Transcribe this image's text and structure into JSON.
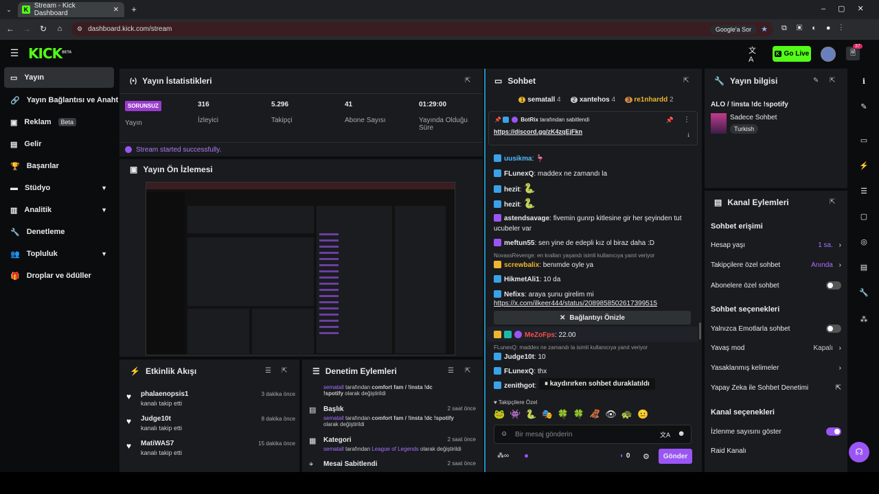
{
  "browser": {
    "tab_title": "Stream - Kick Dashboard",
    "url": "dashboard.kick.com/stream",
    "google_chip": "Google'a Sor"
  },
  "header": {
    "logo": "KICK",
    "logo_beta": "BETA",
    "go_live": "Go Live",
    "notif_count": "37"
  },
  "sidebar": {
    "items": [
      {
        "label": "Yayın"
      },
      {
        "label": "Yayın Bağlantısı ve Anahtar"
      },
      {
        "label": "Reklam",
        "badge": "Beta"
      },
      {
        "label": "Gelir"
      },
      {
        "label": "Başarılar"
      },
      {
        "label": "Stüdyo"
      },
      {
        "label": "Analitik"
      },
      {
        "label": "Denetleme"
      },
      {
        "label": "Topluluk"
      },
      {
        "label": "Droplar ve ödüller"
      }
    ]
  },
  "stats": {
    "title": "Yayın İstatistikleri",
    "offline_badge": "SORUNSUZ",
    "stream_label": "Yayın",
    "items": [
      {
        "value": "316",
        "label": "İzleyici"
      },
      {
        "value": "5.296",
        "label": "Takipçi"
      },
      {
        "value": "41",
        "label": "Abone Sayısı"
      },
      {
        "value": "01:29:00",
        "label": "Yayında Olduğu Süre"
      }
    ],
    "status_msg": "Stream started successfully."
  },
  "preview": {
    "title": "Yayın Ön İzlemesi"
  },
  "activity": {
    "title": "Etkinlik Akışı",
    "rows": [
      {
        "user": "phalaenopsis1",
        "sub": "kanalı takip etti",
        "time": "3 dakika önce"
      },
      {
        "user": "Judge10t",
        "sub": "kanalı takip etti",
        "time": "8 dakika önce"
      },
      {
        "user": "MatiWAS7",
        "sub": "kanalı takip etti",
        "time": "15 dakika önce"
      }
    ]
  },
  "moderation": {
    "title": "Denetim Eylemleri",
    "top_line_a": "sematall",
    "top_line_b": "tarafından",
    "top_line_c": "comfort fam / !insta !dc",
    "top_line2": "!spotify",
    "top_line2_b": "olarak değiştirildi",
    "rows": [
      {
        "title": "Başlık",
        "time": "2 saat önce",
        "by": "sematall",
        "mid": "tarafından",
        "value": "comfort fam / !insta !dc !spotify",
        "end": "olarak değiştirildi"
      },
      {
        "title": "Kategori",
        "time": "2 saat önce",
        "by": "sematall",
        "mid": "tarafından",
        "value": "League of Legends",
        "end": "olarak değiştirildi"
      },
      {
        "title": "Mesai Sabitlendi",
        "time": "2 saat önce"
      }
    ]
  },
  "chat": {
    "title": "Sohbet",
    "top_gifters": [
      {
        "rank": "1",
        "name": "sematall",
        "count": "4"
      },
      {
        "rank": "2",
        "name": "xantehos",
        "count": "4"
      },
      {
        "rank": "3",
        "name": "re1nhardd",
        "count": "2"
      }
    ],
    "pinned": {
      "by": "BotRix",
      "by_suffix": "tarafından sabitlendi",
      "link": "https://discord.gg/zK4zqEjFkn"
    },
    "messages": [
      {
        "user": "uusikma",
        "text": ":",
        "color": "#53b8ff"
      },
      {
        "user": "FLunexQ",
        "text": ": maddex ne zamandı la",
        "color": "#e8eaed"
      },
      {
        "user": "hezit",
        "text": ":",
        "color": "#e8eaed"
      },
      {
        "user": "hezit",
        "text": ":",
        "color": "#e8eaed"
      },
      {
        "user": "astendsavage",
        "text": ": fivemin gunrp kitlesine gir her şeyinden tut ucubeler var",
        "color": "#e8eaed"
      },
      {
        "user": "meftun55",
        "text": ": sen yine de edepli kız ol biraz daha :D",
        "color": "#e8eaed"
      },
      {
        "user": "screwbalix",
        "text": ": benımde oyle ya",
        "color": "#e8eaed"
      },
      {
        "user": "HikmetAli1",
        "text": ": 10 da",
        "color": "#e8eaed"
      },
      {
        "user": "Nefixs",
        "text": ": araya şunu girelim mi",
        "color": "#e8eaed"
      }
    ],
    "reply1": "NovassRevenge: en kralları yaşandı isimli kullanıcıya yanıt veriyor",
    "nefixs_link": "https://x.com/ilkeer444/status/2089858502617399515",
    "preview_btn": "Bağlantıyı Önizle",
    "mezo_user": "MeZoFps",
    "mezo_text": ": 22.00",
    "reply2": "FLunexQ: maddex ne zamandı la isimli kullanıcıya yanıt veriyor",
    "judge_user": "Judge10t",
    "judge_text": ": 10",
    "flu_user": "FLunexQ",
    "flu_text": ": thx",
    "zen_user": "zenithgot",
    "zen_text": ":",
    "paused": "kaydırırken sohbet duraklatıldı",
    "followers_only": "Takipçilere Özel",
    "placeholder": "Bir mesaj gönderin",
    "send": "Gönder",
    "points": "0"
  },
  "info": {
    "title": "Yayın bilgisi",
    "stream_title": "ALO / !insta !dc !spotify",
    "category": "Sadece Sohbet",
    "tag": "Turkish"
  },
  "actions": {
    "title": "Kanal Eylemleri",
    "sec1": "Sohbet erişimi",
    "hesap": "Hesap yaşı",
    "hesap_val": "1 sa.",
    "takip": "Takipçilere özel sohbet",
    "takip_val": "Anında",
    "abone": "Abonelere özel sohbet",
    "sec2": "Sohbet seçenekleri",
    "emote": "Yalnızca Emotlarla sohbet",
    "yavas": "Yavaş mod",
    "yavas_val": "Kapalı",
    "yasak": "Yasaklanmış kelimeler",
    "ai": "Yapay Zeka ile Sohbet Denetimi",
    "sec3": "Kanal seçenekleri",
    "izlenme": "İzlenme sayısını göster",
    "raid": "Raid Kanalı"
  }
}
